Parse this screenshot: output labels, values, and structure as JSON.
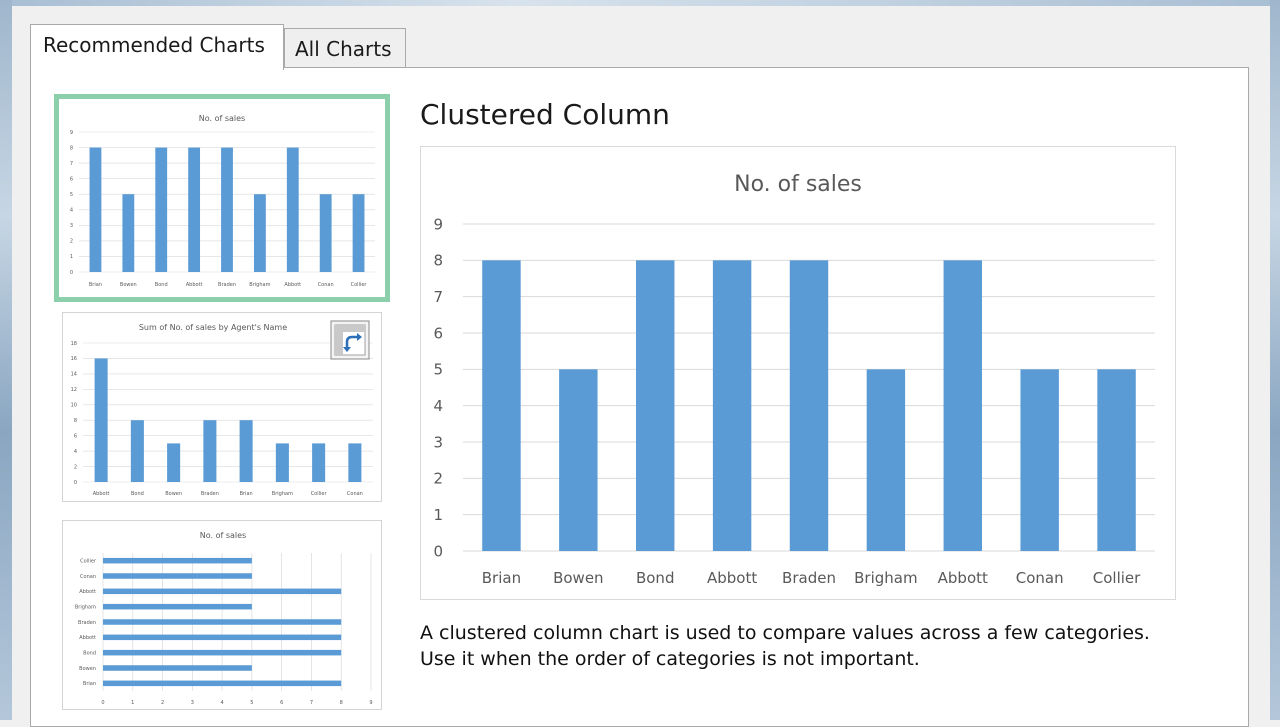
{
  "tabs": [
    {
      "label": "Recommended Charts",
      "active": true
    },
    {
      "label": "All Charts",
      "active": false
    }
  ],
  "colors": {
    "bar": "#5b9bd5",
    "selected_border": "#8ccfab",
    "grid": "#d9d9d9"
  },
  "icons": {
    "pivot": "pivot-chart-icon"
  },
  "selected_chart": {
    "type_name": "Clustered Column",
    "description_lines": [
      "A clustered column chart is used to compare values across a few categories.",
      "Use it when the order of categories is not important."
    ]
  },
  "chart_data": [
    {
      "id": "preview",
      "type": "bar",
      "title": "No. of sales",
      "categories": [
        "Brian",
        "Bowen",
        "Bond",
        "Abbott",
        "Braden",
        "Brigham",
        "Abbott",
        "Conan",
        "Collier"
      ],
      "values": [
        8,
        5,
        8,
        8,
        8,
        5,
        8,
        5,
        5
      ],
      "ylim": [
        0,
        9
      ],
      "yticks": [
        0,
        1,
        2,
        3,
        4,
        5,
        6,
        7,
        8,
        9
      ],
      "grid": true
    },
    {
      "id": "thumb1",
      "type": "bar",
      "title": "No. of sales",
      "categories": [
        "Brian",
        "Bowen",
        "Bond",
        "Abbott",
        "Braden",
        "Brigham",
        "Abbott",
        "Conan",
        "Collier"
      ],
      "values": [
        8,
        5,
        8,
        8,
        8,
        5,
        8,
        5,
        5
      ],
      "ylim": [
        0,
        9
      ],
      "yticks": [
        0,
        1,
        2,
        3,
        4,
        5,
        6,
        7,
        8,
        9
      ],
      "grid": true
    },
    {
      "id": "thumb2",
      "type": "bar",
      "title": "Sum of No. of sales by Agent's Name",
      "categories": [
        "Abbott",
        "Bond",
        "Bowen",
        "Braden",
        "Brian",
        "Brigham",
        "Collier",
        "Conan"
      ],
      "values": [
        16,
        8,
        5,
        8,
        8,
        5,
        5,
        5
      ],
      "ylim": [
        0,
        18
      ],
      "yticks": [
        0,
        2,
        4,
        6,
        8,
        10,
        12,
        14,
        16,
        18
      ],
      "grid": true
    },
    {
      "id": "thumb3",
      "type": "bar",
      "orientation": "horizontal",
      "title": "No. of sales",
      "categories": [
        "Brian",
        "Bowen",
        "Bond",
        "Abbott",
        "Braden",
        "Brigham",
        "Abbott",
        "Conan",
        "Collier"
      ],
      "values": [
        8,
        5,
        8,
        8,
        8,
        5,
        8,
        5,
        5
      ],
      "xlim": [
        0,
        9
      ],
      "xticks": [
        0,
        1,
        2,
        3,
        4,
        5,
        6,
        7,
        8,
        9
      ],
      "grid": true
    }
  ]
}
